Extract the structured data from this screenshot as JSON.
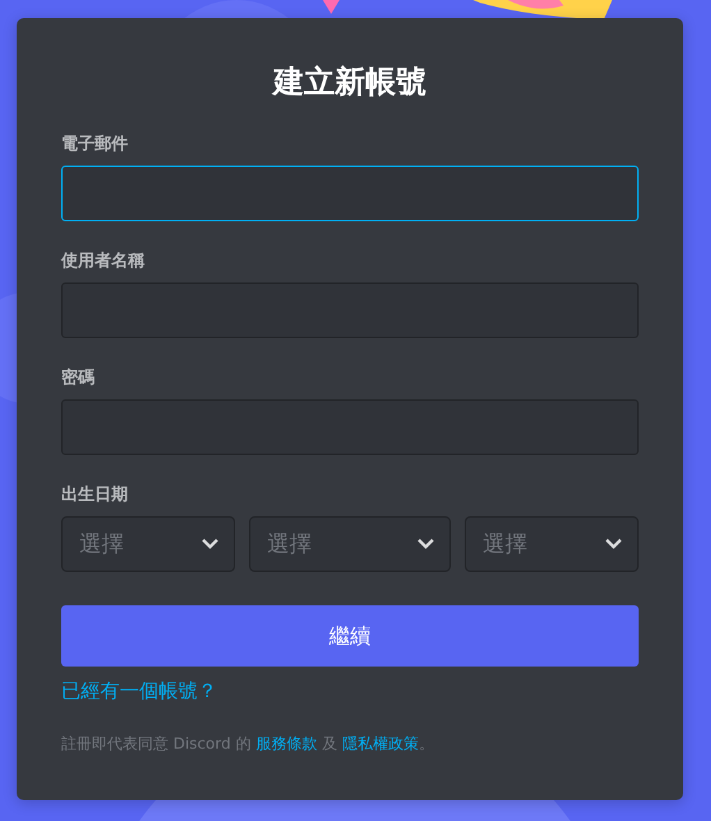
{
  "title": "建立新帳號",
  "fields": [
    {
      "label": "電子郵件",
      "focused": true
    },
    {
      "label": "使用者名稱",
      "focused": false
    },
    {
      "label": "密碼",
      "focused": false
    }
  ],
  "birthdate": {
    "label": "出生日期",
    "selects": [
      {
        "placeholder": "選擇"
      },
      {
        "placeholder": "選擇"
      },
      {
        "placeholder": "選擇"
      }
    ]
  },
  "submit_button": "繼續",
  "login_link": "已經有一個帳號？",
  "terms": {
    "before": "註冊即代表同意 Discord 的 ",
    "terms_link": "服務條款",
    "middle": " 及 ",
    "privacy_link": "隱私權政策",
    "after": "。"
  }
}
